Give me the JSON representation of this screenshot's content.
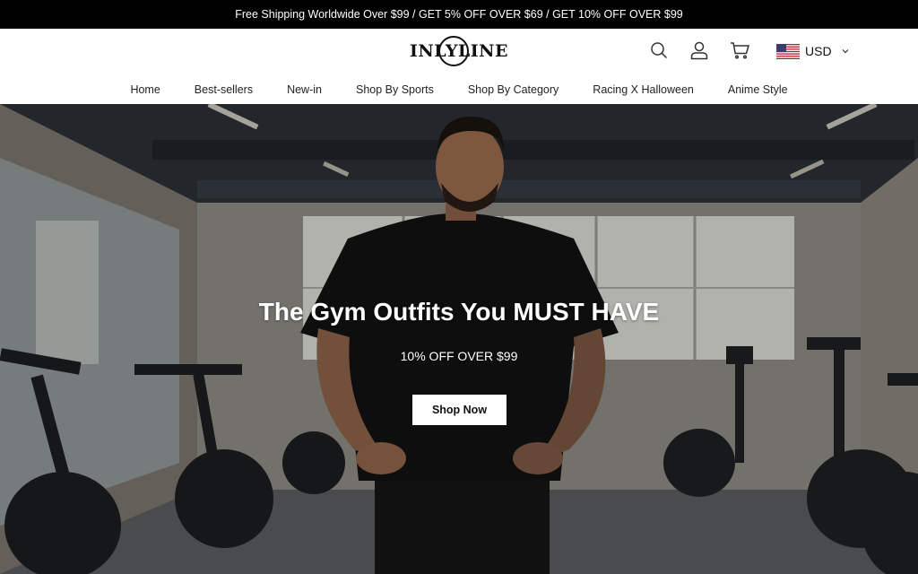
{
  "announcement": "Free Shipping Worldwide Over $99 / GET 5% OFF OVER $69 / GET 10% OFF OVER $99",
  "header": {
    "logo": "INLYLINE",
    "icons": [
      "search-icon",
      "account-icon",
      "cart-icon"
    ],
    "currency": "USD"
  },
  "nav": {
    "items": [
      {
        "label": "Home"
      },
      {
        "label": "Best-sellers"
      },
      {
        "label": "New-in"
      },
      {
        "label": "Shop By Sports"
      },
      {
        "label": "Shop By Category"
      },
      {
        "label": "Racing X Halloween"
      },
      {
        "label": "Anime Style"
      }
    ]
  },
  "hero": {
    "title": "The Gym Outfits You MUST HAVE",
    "subtitle": "10% OFF OVER $99",
    "button": "Shop Now"
  },
  "colors": {
    "announcement_bg": "#000000",
    "text": "#111111",
    "button_bg": "#ffffff"
  }
}
